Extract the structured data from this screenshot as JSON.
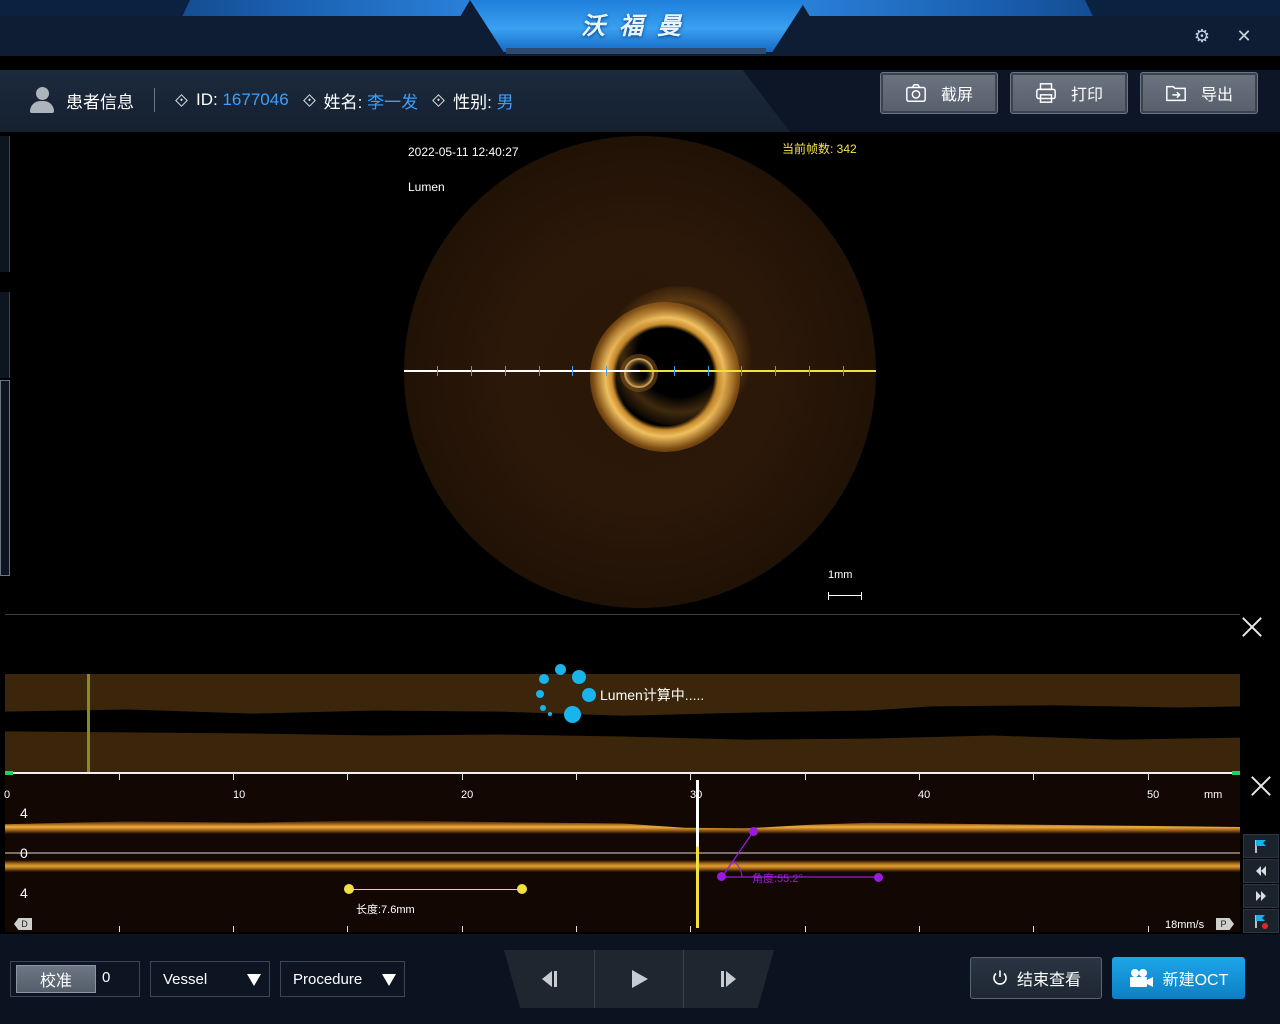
{
  "app": {
    "title": "沃福曼"
  },
  "patient": {
    "section_label": "患者信息",
    "id_label": "ID:",
    "id_value": "1677046",
    "name_label": "姓名:",
    "name_value": "李一发",
    "sex_label": "性别:",
    "sex_value": "男"
  },
  "actions": {
    "screenshot_label": "截屏",
    "print_label": "打印",
    "export_label": "导出"
  },
  "oct": {
    "datetime": "2022-05-11 12:40:27",
    "overlay_label": "Lumen",
    "frame_label": "当前帧数: 342",
    "scale_label": "1mm"
  },
  "lumen_profile": {
    "status_text": "Lumen计算中....."
  },
  "longitudinal": {
    "axis_labels": [
      "0",
      "10",
      "20",
      "30",
      "40",
      "50"
    ],
    "axis_unit": "mm",
    "depth_labels": [
      "4",
      "0",
      "4"
    ],
    "length_label": "长度:7.6mm",
    "angle_label": "角度:55.2°",
    "d_tag": "D",
    "p_tag": "P",
    "speed": "18mm/s"
  },
  "controls": {
    "calibrate_label": "校准",
    "calibrate_value": "0",
    "vessel_dropdown": "Vessel",
    "procedure_dropdown": "Procedure",
    "end_view_label": "结束查看",
    "new_oct_label": "新建OCT"
  },
  "colors": {
    "accent": "#3aa0ff",
    "frame_text": "#f4e44a",
    "spinner": "#19b4ec",
    "length_measure": "#f0e040",
    "angle_measure": "#9a1ae0"
  }
}
